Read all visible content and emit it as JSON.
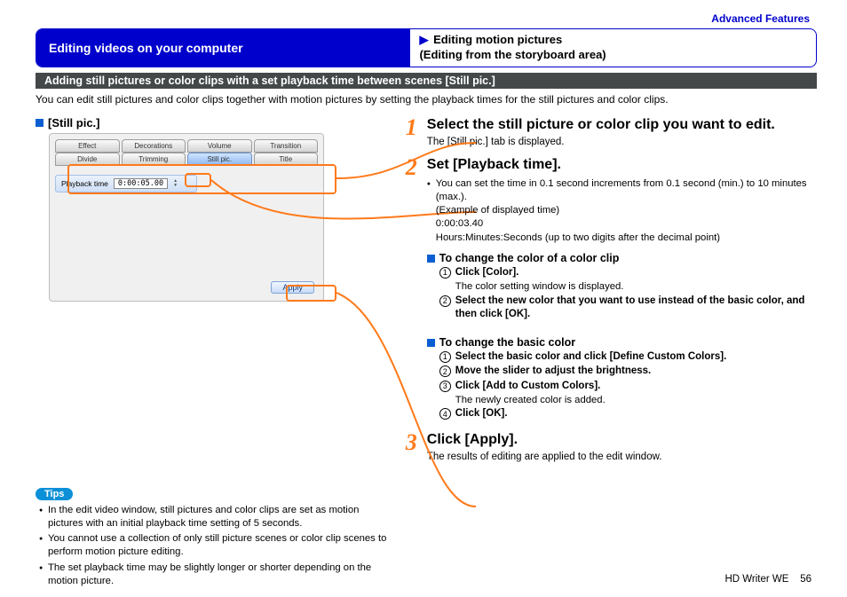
{
  "top_link": "Advanced Features",
  "header": {
    "left": "Editing videos on your computer",
    "right_line1": "Editing motion pictures",
    "right_line2": "(Editing from the storyboard area)"
  },
  "blackbar": "Adding still pictures or color clips with a set playback time between scenes [Still pic.]",
  "intro": "You can edit still pictures and color clips together with motion pictures by setting the playback times for the still pictures and color clips.",
  "panel_label": "[Still pic.]",
  "panel": {
    "tabs_row1": [
      "Effect",
      "Decorations",
      "Volume",
      "Transition"
    ],
    "tabs_row2": [
      "Divide",
      "Trimming",
      "Still pic.",
      "Title"
    ],
    "active_tab_index": 2,
    "playback_label": "Playback time",
    "playback_value": "0:00:05.00",
    "apply": "Apply"
  },
  "tips_label": "Tips",
  "tips": [
    "In the edit video window, still pictures and color clips are set as motion pictures with an initial playback time setting of 5 seconds.",
    "You cannot use a collection of only still picture scenes or color clip scenes to perform motion picture editing.",
    "The set playback time may be slightly longer or shorter depending on the motion picture."
  ],
  "steps": {
    "s1": {
      "num": "1",
      "title": "Select the still picture or color clip you want to edit.",
      "sub": "The [Still pic.] tab is displayed."
    },
    "s2": {
      "num": "2",
      "title": "Set [Playback time].",
      "bullet": "You can set the time in 0.1 second increments from 0.1 second (min.) to 10 minutes (max.).",
      "example_l1": "(Example of displayed time)",
      "example_l2": "0:00:03.40",
      "example_l3": "Hours:Minutes:Seconds (up to two digits after the decimal point)",
      "sub1_title": "To change the color of a color clip",
      "sub1_items": [
        {
          "b": "Click [Color].",
          "n": "The color setting window is displayed."
        },
        {
          "b": "Select the new color that you want to use instead of the basic color, and then click [OK].",
          "n": ""
        }
      ],
      "sub2_title": "To change the basic color",
      "sub2_items": [
        {
          "b": "Select the basic color and click [Define Custom Colors].",
          "n": ""
        },
        {
          "b": "Move the slider to adjust the brightness.",
          "n": ""
        },
        {
          "b": "Click [Add to Custom Colors].",
          "n": "The newly created color is added."
        },
        {
          "b": "Click [OK].",
          "n": ""
        }
      ]
    },
    "s3": {
      "num": "3",
      "title": "Click [Apply].",
      "sub": "The results of editing are applied to the edit window."
    }
  },
  "footer": {
    "product": "HD Writer WE",
    "page": "56"
  }
}
